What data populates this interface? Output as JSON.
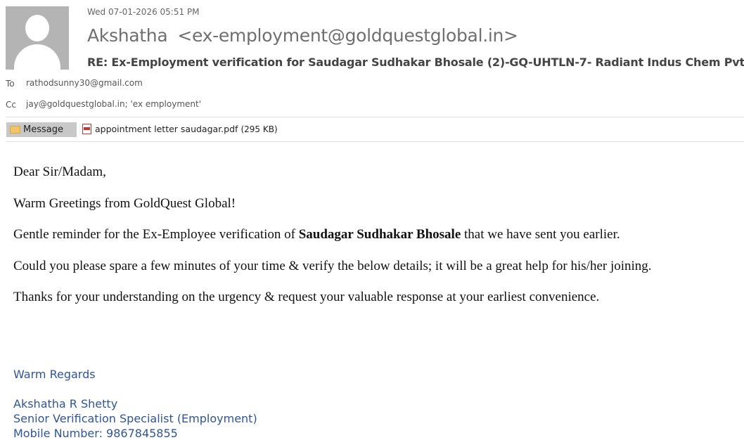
{
  "header": {
    "date": "Wed 07-01-2026 05:51 PM",
    "sender_name": "Akshatha",
    "sender_address": "<ex-employment@goldquestglobal.in>",
    "subject": "RE: Ex-Employment verification for Saudagar Sudhakar Bhosale (2)-GQ-UHTLN-7- Radiant Indus Chem Pvt Ltd",
    "to_label": "To",
    "to_value": "rathodsunny30@gmail.com",
    "cc_label": "Cc",
    "cc_value": "jay@goldquestglobal.in; 'ex employment'"
  },
  "attachments": {
    "message_tab": "Message",
    "file_name": "appointment letter saudagar.pdf",
    "file_size": "(295 KB)"
  },
  "body": {
    "greeting": "Dear Sir/Madam,",
    "line1": "Warm Greetings from GoldQuest Global!",
    "line2_pre": "Gentle reminder for the Ex-Employee verification of ",
    "line2_bold": "Saudagar Sudhakar Bhosale",
    "line2_post": " that we have sent you earlier.",
    "line3": "Could you please spare a few minutes of your time & verify the below details; it will be a great help for his/her joining.",
    "line4": "Thanks for your understanding on the urgency & request your valuable response at your earliest convenience."
  },
  "signature": {
    "closing": "Warm Regards",
    "name": "Akshatha R Shetty",
    "title": "Senior Verification Specialist (Employment)",
    "mobile_partial": "Mobile Number: 9867845855"
  },
  "colors": {
    "signature_blue": "#2f5597",
    "tab_gray": "#c8c8c8"
  }
}
